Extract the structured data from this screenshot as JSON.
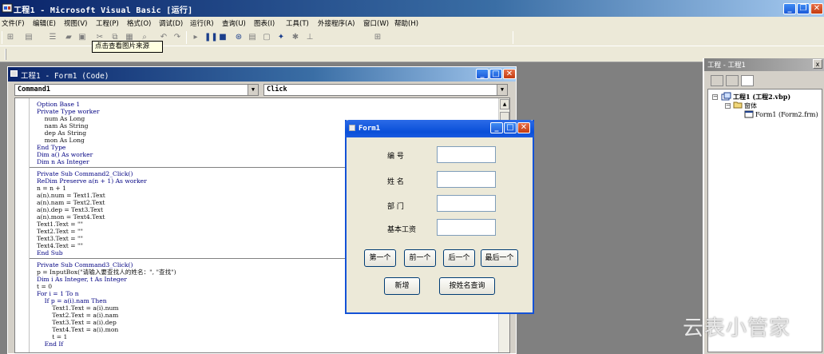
{
  "app": {
    "title": "工程1 - Microsoft Visual Basic [运行]"
  },
  "menu": [
    "文件(F)",
    "编辑(E)",
    "视图(V)",
    "工程(P)",
    "格式(O)",
    "调试(D)",
    "运行(R)",
    "查询(U)",
    "图表(I)",
    "工具(T)",
    "外接程序(A)",
    "窗口(W)",
    "帮助(H)"
  ],
  "tooltip": "点击查看图片来源",
  "code_window": {
    "title": "工程1 - Form1 (Code)",
    "object_combo": "Command1",
    "proc_combo": "Click",
    "lines": [
      "Option Base 1",
      "Private Type worker",
      "    num As Long",
      "    nam As String",
      "    dep As String",
      "    mon As Long",
      "End Type",
      "Dim a() As worker",
      "Dim n As Integer",
      "Private Sub Command2_Click()",
      "ReDim Preserve a(n + 1) As worker",
      "n = n + 1",
      "a(n).num = Text1.Text",
      "a(n).nam = Text2.Text",
      "a(n).dep = Text3.Text",
      "a(n).mon = Text4.Text",
      "Text1.Text = \"\"",
      "Text2.Text = \"\"",
      "Text3.Text = \"\"",
      "Text4.Text = \"\"",
      "End Sub",
      "Private Sub Command3_Click()",
      "p = InputBox(\"请输入要查找人的姓名：\", \"查找\")",
      "Dim i As Integer, t As Integer",
      "t = 0",
      "For i = 1 To n",
      "    If p = a(i).nam Then",
      "        Text1.Text = a(i).num",
      "        Text2.Text = a(i).nam",
      "        Text3.Text = a(i).dep",
      "        Text4.Text = a(i).mon",
      "        t = 1",
      "    End If"
    ]
  },
  "form1": {
    "title": "Form1",
    "labels": [
      "编 号",
      "姓 名",
      "部 门",
      "基本工资"
    ],
    "nav_buttons": [
      "第一个",
      "前一个",
      "后一个",
      "最后一个"
    ],
    "add_button": "新增",
    "search_button": "按姓名查询"
  },
  "project": {
    "title": "工程 - 工程1",
    "close": "x",
    "root": "工程1 (工程2.vbp)",
    "folder": "窗体",
    "form": "Form1 (Form2.frm)"
  },
  "watermark": "云表小管家",
  "colors": {
    "title_bar": "#0a246a",
    "xp_title": "#0a4fd8",
    "face": "#ece9d8",
    "workspace": "#808080",
    "keyword": "#000082"
  }
}
